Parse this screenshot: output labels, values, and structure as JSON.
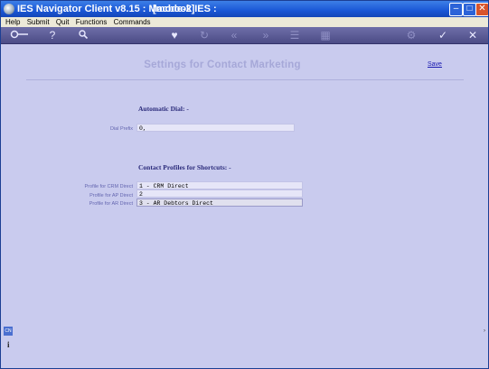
{
  "window": {
    "title": "IES Navigator Client v8.15 : Macbook IES :",
    "mode": "[mode-2]"
  },
  "menu": [
    "Help",
    "Submit",
    "Quit",
    "Functions",
    "Commands"
  ],
  "toolbar": {
    "icons": [
      "key-icon",
      "help-icon",
      "search-icon",
      "heart-icon",
      "refresh-icon",
      "rewind-icon",
      "fast-forward-icon",
      "tree-icon",
      "grid-icon",
      "gear-icon",
      "check-icon",
      "close-icon"
    ]
  },
  "page": {
    "title": "Settings for Contact Marketing",
    "save_label": "Save"
  },
  "automatic_dial": {
    "heading": "Automatic Dial: -",
    "dial_prefix_label": "Dial Prefix",
    "dial_prefix_value": "0,"
  },
  "shortcuts": {
    "heading": "Contact Profiles for Shortcuts: -",
    "rows": [
      {
        "label": "Profile for CRM Direct",
        "value": "1 - CRM Direct"
      },
      {
        "label": "Profile for AP Direct",
        "value": "2"
      },
      {
        "label": "Profile for AR Direct",
        "value": "3 - AR Debtors Direct"
      }
    ]
  },
  "side": {
    "left_tab": "CN",
    "right_arrow": "›"
  }
}
